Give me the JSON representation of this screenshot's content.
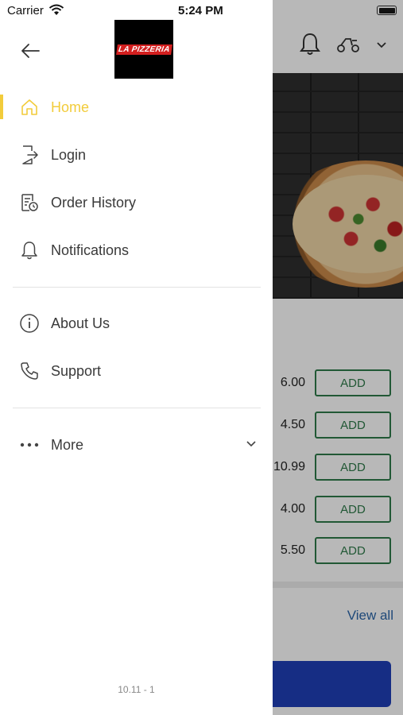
{
  "status_bar": {
    "carrier": "Carrier",
    "time": "5:24 PM"
  },
  "logo": {
    "text": "LA PIZZERIA"
  },
  "menu": {
    "items": [
      {
        "label": "Home",
        "icon": "home-icon",
        "active": true
      },
      {
        "label": "Login",
        "icon": "login-icon"
      },
      {
        "label": "Order History",
        "icon": "order-history-icon"
      },
      {
        "label": "Notifications",
        "icon": "bell-icon"
      },
      {
        "label": "About Us",
        "icon": "info-icon"
      },
      {
        "label": "Support",
        "icon": "phone-icon"
      },
      {
        "label": "More",
        "icon": "more-dots-icon"
      }
    ]
  },
  "version": "10.11 - 1",
  "colors": {
    "accent": "#f2cc3b",
    "add_button": "#2f7a4a",
    "link": "#2b66a8",
    "cta": "#1f3fb8"
  },
  "background": {
    "prices": [
      "6.00",
      "4.50",
      "10.99",
      "4.00",
      "5.50"
    ],
    "add_label": "ADD",
    "view_all": "View all"
  }
}
